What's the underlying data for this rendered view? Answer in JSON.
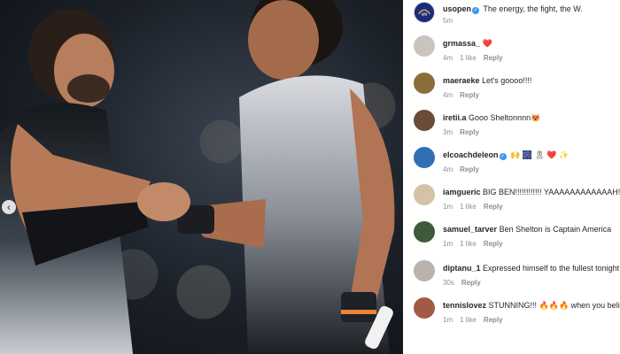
{
  "photo": {
    "alt": "Two tennis players shaking hands at the net",
    "prev_glyph": "‹"
  },
  "caption": {
    "username": "usopen",
    "text": "The energy, the fight, the W.",
    "time": "5m",
    "verified_glyph": "✓"
  },
  "comments": [
    {
      "username": "grmassa_",
      "text": "❤️",
      "time": "4m",
      "likes": "1 like",
      "reply": "Reply",
      "verified": false,
      "avatar_color": "#c9c4be"
    },
    {
      "username": "maeraeke",
      "text": "Let's goooo!!!!",
      "time": "4m",
      "likes": "",
      "reply": "Reply",
      "verified": false,
      "avatar_color": "#8a6d3b"
    },
    {
      "username": "iretii.a",
      "text": "Gooo Sheltonnnn😻",
      "time": "3m",
      "likes": "",
      "reply": "Reply",
      "verified": false,
      "avatar_color": "#6b4a3a"
    },
    {
      "username": "elcoachdeleon",
      "text": "🙌 🎆 🎗 ❤️ ✨",
      "time": "4m",
      "likes": "",
      "reply": "Reply",
      "verified": true,
      "avatar_color": "#2f6fb3"
    },
    {
      "username": "iamgueric",
      "text": "BIG BEN!!!!!!!!!!!! YAAAAAAAAAAAAH!!!!",
      "time": "1m",
      "likes": "1 like",
      "reply": "Reply",
      "verified": false,
      "avatar_color": "#d6c3a5"
    },
    {
      "username": "samuel_tarver",
      "text": "Ben Shelton is Captain America",
      "time": "1m",
      "likes": "1 like",
      "reply": "Reply",
      "verified": false,
      "avatar_color": "#3f5a3a"
    },
    {
      "username": "diptanu_1",
      "text": "Expressed himself to the fullest tonight",
      "time": "30s",
      "likes": "",
      "reply": "Reply",
      "verified": false,
      "avatar_color": "#b9b3ad"
    },
    {
      "username": "tennislovez",
      "text": "STUNNING!!! 🔥🔥🔥 when you belie possible!!! 👅",
      "time": "1m",
      "likes": "1 like",
      "reply": "Reply",
      "verified": false,
      "avatar_color": "#a35a45"
    }
  ]
}
